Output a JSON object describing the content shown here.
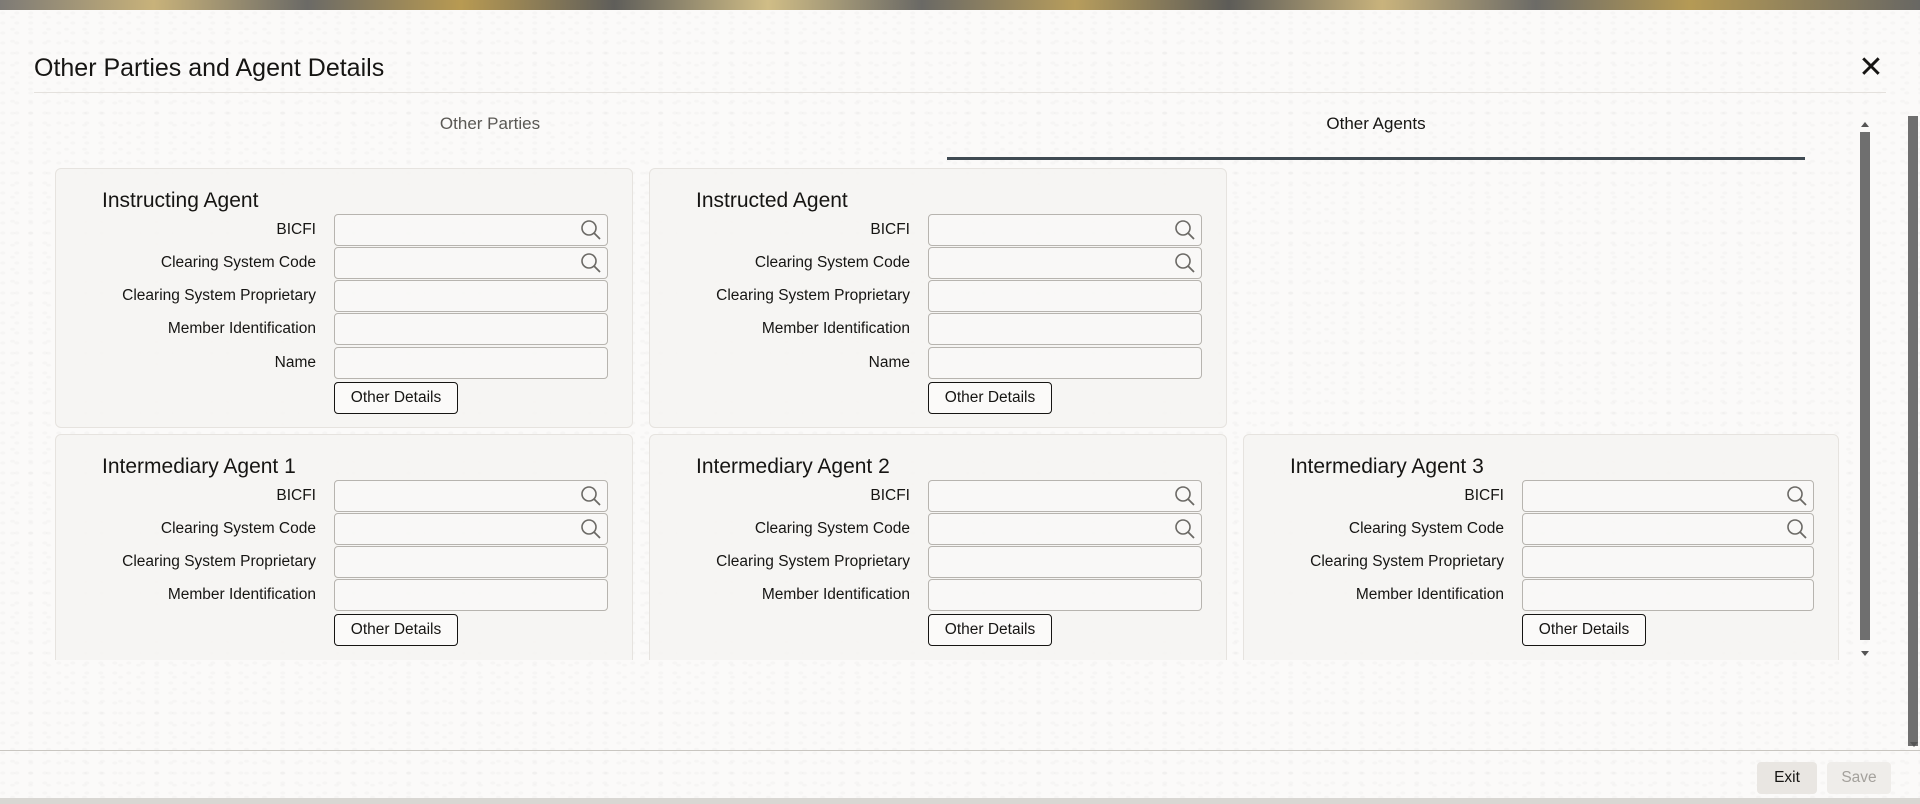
{
  "dialog": {
    "title": "Other Parties and Agent Details",
    "close_label": "✕"
  },
  "tabs": [
    {
      "label": "Other Parties",
      "selected": false
    },
    {
      "label": "Other Agents",
      "selected": true
    }
  ],
  "field_labels": {
    "bicfi": "BICFI",
    "clearing_system_code": "Clearing System Code",
    "clearing_system_proprietary": "Clearing System Proprietary",
    "member_identification": "Member Identification",
    "name": "Name"
  },
  "other_details_label": "Other Details",
  "panels": {
    "instructing_agent": {
      "title": "Instructing Agent"
    },
    "instructed_agent": {
      "title": "Instructed Agent"
    },
    "intermediary_agent_1": {
      "title": "Intermediary Agent 1"
    },
    "intermediary_agent_2": {
      "title": "Intermediary Agent 2"
    },
    "intermediary_agent_3": {
      "title": "Intermediary Agent 3"
    }
  },
  "footer": {
    "exit_label": "Exit",
    "save_label": "Save",
    "save_enabled": false
  },
  "icons": {
    "lookup": "search-icon",
    "close": "close-icon"
  },
  "colors": {
    "tab_underline": "#3f4a52",
    "text": "#161513",
    "disabled_text": "#a4a19c"
  }
}
